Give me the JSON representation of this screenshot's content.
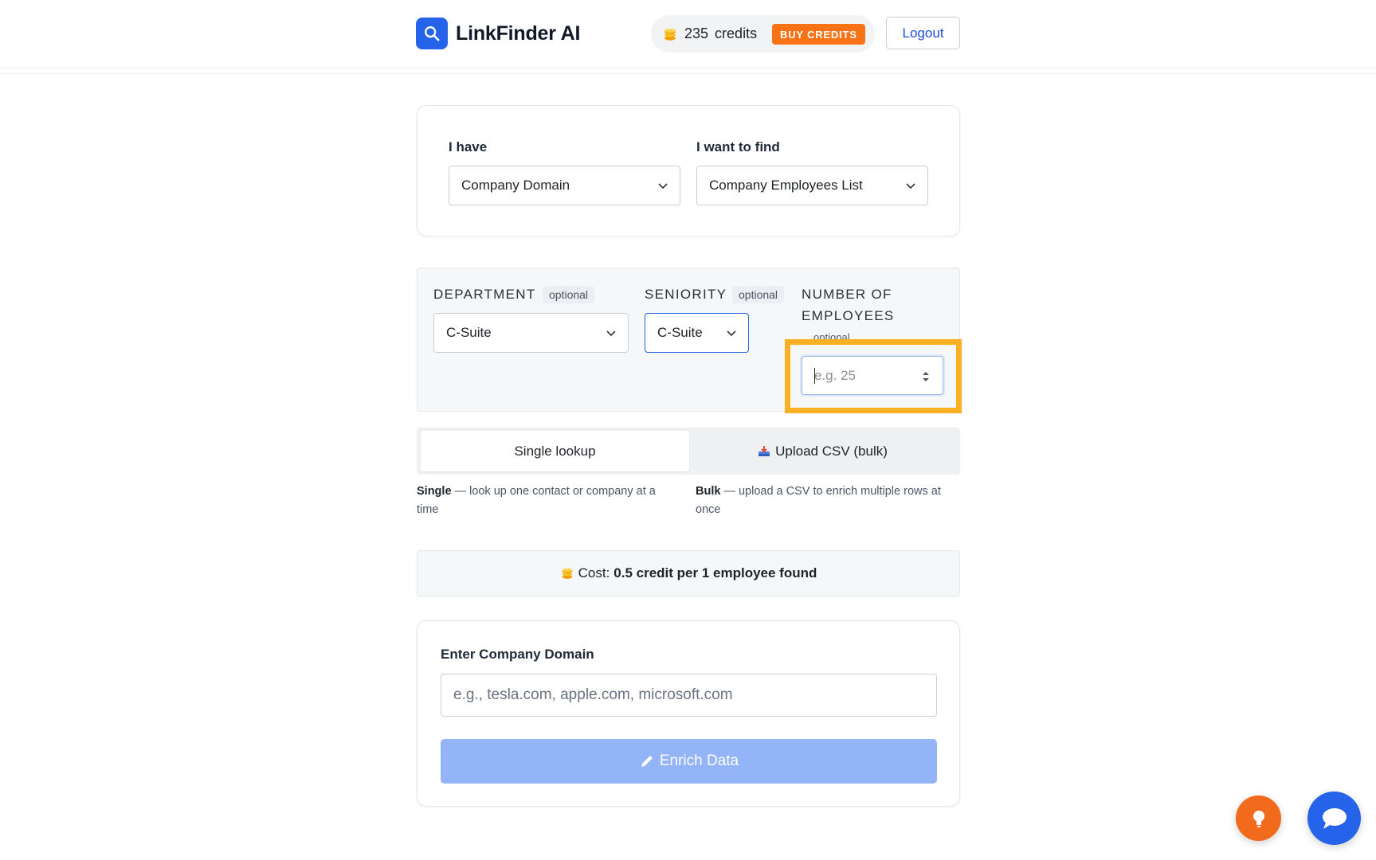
{
  "header": {
    "brand_name": "LinkFinder AI",
    "credits_count": "235",
    "credits_label": "credits",
    "buy_credits_label": "BUY CREDITS",
    "logout_label": "Logout"
  },
  "source_target": {
    "have_label": "I have",
    "have_value": "Company Domain",
    "find_label": "I want to find",
    "find_value": "Company Employees List"
  },
  "filters": {
    "department_label": "DEPARTMENT",
    "department_optional": "optional",
    "department_value": "C-Suite",
    "seniority_label": "SENIORITY",
    "seniority_optional": "optional",
    "seniority_value": "C-Suite",
    "num_employees_label_line1": "NUMBER OF",
    "num_employees_label_line2": "EMPLOYEES",
    "num_employees_optional": "optional",
    "num_employees_placeholder": "e.g. 25"
  },
  "mode_tabs": {
    "single_label": "Single lookup",
    "bulk_label": "Upload CSV (bulk)",
    "single_desc_bold": "Single",
    "single_desc": " — look up one contact or company at a time",
    "bulk_desc_bold": "Bulk",
    "bulk_desc": " — upload a CSV to enrich multiple rows at once"
  },
  "cost": {
    "prefix": "Cost:",
    "value": "0.5 credit per 1 employee found"
  },
  "domain_form": {
    "label": "Enter Company Domain",
    "placeholder": "e.g., tesla.com, apple.com, microsoft.com",
    "submit_label": "Enrich Data"
  },
  "colors": {
    "brand_blue": "#2563eb",
    "accent_orange": "#f97316",
    "highlight": "#fbb024",
    "disabled_button": "#93b4f7"
  },
  "icons": [
    "search-icon",
    "coins-icon",
    "chevron-down-icon",
    "spinner-arrows-icon",
    "inbox-tray-icon",
    "pencil-icon",
    "lightbulb-icon",
    "chat-bubble-icon"
  ]
}
